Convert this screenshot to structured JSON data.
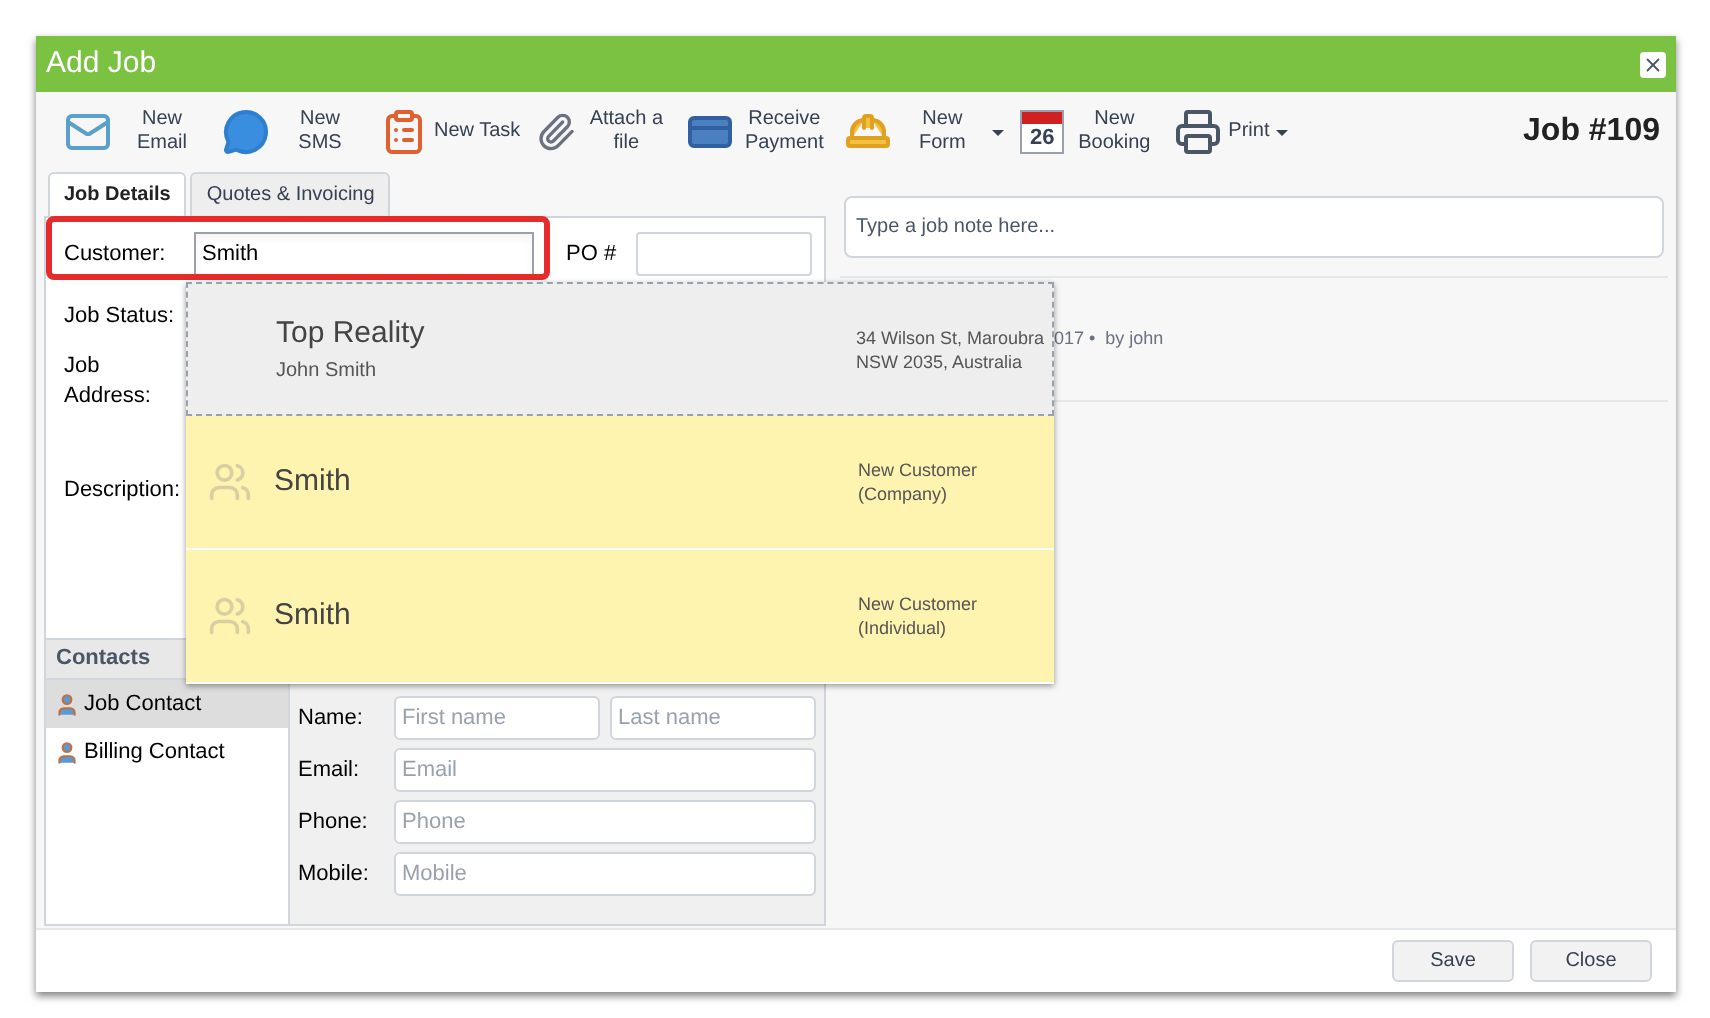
{
  "window": {
    "title": "Add Job"
  },
  "toolbar": [
    {
      "kind": "email",
      "label": "New Email"
    },
    {
      "kind": "sms",
      "label": "New SMS"
    },
    {
      "kind": "task",
      "label": "New Task"
    },
    {
      "kind": "attach",
      "label": "Attach a file"
    },
    {
      "kind": "payment",
      "label": "Receive Payment"
    },
    {
      "kind": "form",
      "label": "New Form",
      "menu": true
    },
    {
      "kind": "booking",
      "label": "New Booking",
      "day": "26"
    },
    {
      "kind": "print",
      "label": "Print",
      "menu": true
    }
  ],
  "job_number": "Job #109",
  "tabs": [
    {
      "label": "Job Details",
      "selected": true
    },
    {
      "label": "Quotes & Invoicing",
      "selected": false
    }
  ],
  "customer": {
    "label": "Customer:",
    "value": "Smith",
    "highlighted": true
  },
  "po": {
    "label": "PO #"
  },
  "fields": [
    "Job Status:",
    "Job Address:",
    "Description:"
  ],
  "suggestions": [
    {
      "kind": "existing",
      "name": "Top Reality",
      "contact": "John Smith",
      "detail": "34 Wilson St, Maroubra NSW 2035, Australia",
      "selected": true
    },
    {
      "kind": "new",
      "name": "Smith",
      "detail": "New Customer (Company)",
      "selected": false
    },
    {
      "kind": "new",
      "name": "Smith",
      "detail": "New Customer (Individual)",
      "selected": false
    }
  ],
  "contacts": {
    "title": "Contacts",
    "items": [
      {
        "label": "Job Contact",
        "selected": true
      },
      {
        "label": "Billing Contact",
        "selected": false
      }
    ],
    "form": [
      {
        "label": "Name:",
        "placeholders": [
          "First name",
          "Last name"
        ]
      },
      {
        "label": "Email:",
        "placeholders": [
          "Email"
        ]
      },
      {
        "label": "Phone:",
        "placeholders": [
          "Phone"
        ]
      },
      {
        "label": "Mobile:",
        "placeholders": [
          "Mobile"
        ]
      }
    ]
  },
  "note": {
    "placeholder": "Type a job note here...",
    "entry": "017 •  by john"
  },
  "buttons": [
    "Save",
    "Close"
  ]
}
